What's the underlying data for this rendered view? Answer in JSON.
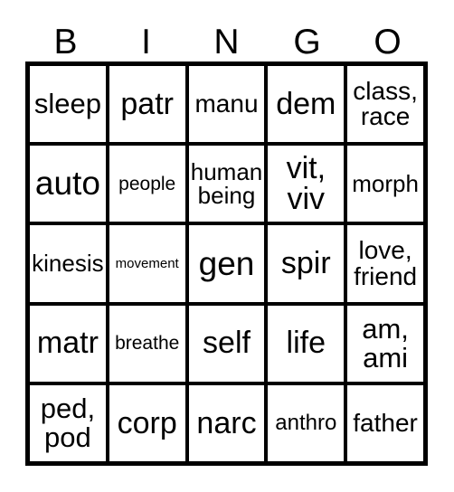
{
  "card": {
    "title_letters": [
      "B",
      "I",
      "N",
      "G",
      "O"
    ],
    "border_color": "#000000",
    "background_color": "#ffffff",
    "text_color": "#000000",
    "rows": 5,
    "columns": 5,
    "cells": [
      [
        {
          "text": "sleep",
          "size": "xl"
        },
        {
          "text": "patr",
          "size": "xxl"
        },
        {
          "text": "manu",
          "size": "l"
        },
        {
          "text": "dem",
          "size": "xxl"
        },
        {
          "text": "class,\nrace",
          "size": "l"
        }
      ],
      [
        {
          "text": "auto",
          "size": "h"
        },
        {
          "text": "people",
          "size": "s"
        },
        {
          "text": "human\nbeing",
          "size": "ml"
        },
        {
          "text": "vit,\nviv",
          "size": "xxl"
        },
        {
          "text": "morph",
          "size": "ml"
        }
      ],
      [
        {
          "text": "kinesis",
          "size": "ml"
        },
        {
          "text": "movement",
          "size": "xs"
        },
        {
          "text": "gen",
          "size": "h"
        },
        {
          "text": "spir",
          "size": "xxl"
        },
        {
          "text": "love,\nfriend",
          "size": "l"
        }
      ],
      [
        {
          "text": "matr",
          "size": "xxl"
        },
        {
          "text": "breathe",
          "size": "s"
        },
        {
          "text": "self",
          "size": "xxl"
        },
        {
          "text": "life",
          "size": "xxl"
        },
        {
          "text": "am,\nami",
          "size": "xl"
        }
      ],
      [
        {
          "text": "ped,\npod",
          "size": "xl"
        },
        {
          "text": "corp",
          "size": "xxl"
        },
        {
          "text": "narc",
          "size": "xxl"
        },
        {
          "text": "anthro",
          "size": "m"
        },
        {
          "text": "father",
          "size": "l"
        }
      ]
    ]
  }
}
